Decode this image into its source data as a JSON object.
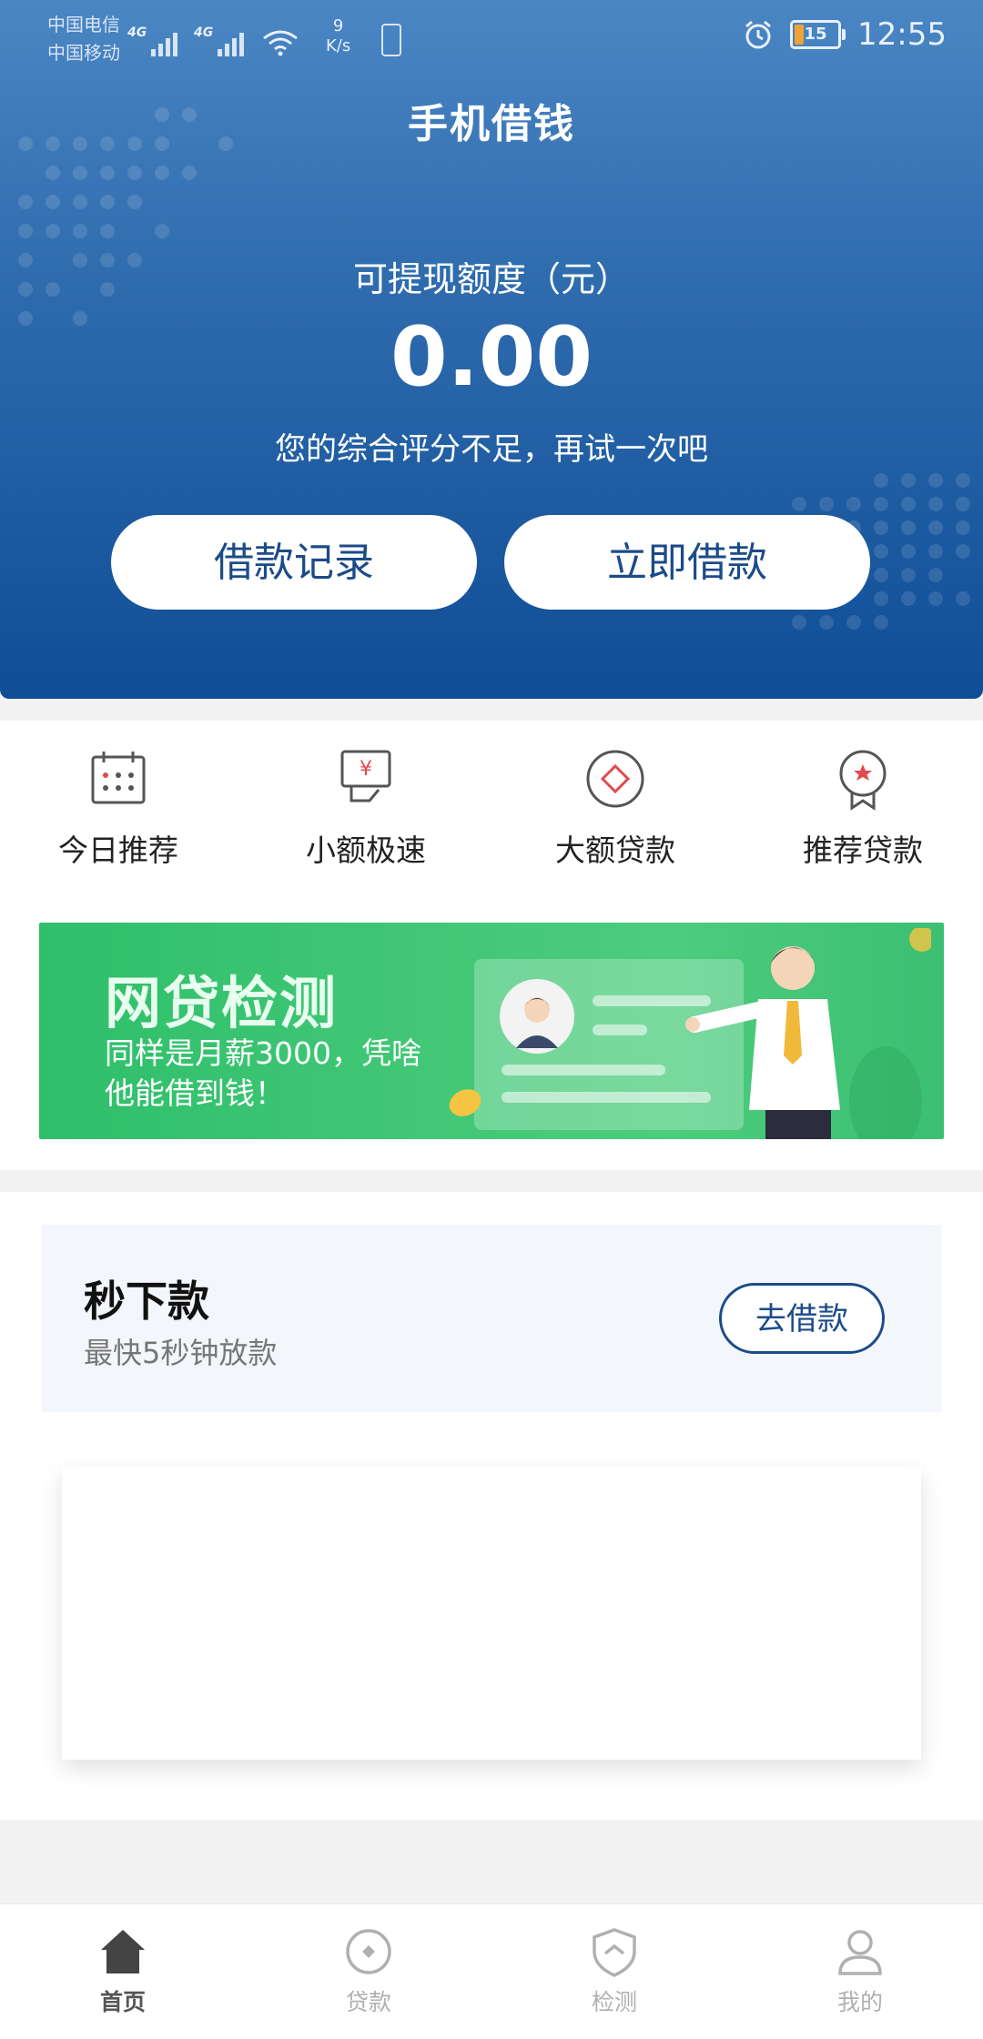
{
  "status_bar": {
    "carrier_1": "中国电信",
    "carrier_2": "中国移动",
    "net_1": "4G",
    "net_2": "4G",
    "speed_value": "9",
    "speed_unit": "K/s",
    "battery_level": "15",
    "time": "12:55"
  },
  "header": {
    "title": "手机借钱",
    "quota_label": "可提现额度（元）",
    "quota_amount": "0.00",
    "hint": "您的综合评分不足，再试一次吧",
    "btn_records": "借款记录",
    "btn_borrow": "立即借款"
  },
  "categories": [
    {
      "label": "今日推荐",
      "icon": "calendar-icon"
    },
    {
      "label": "小额极速",
      "icon": "money-hand-icon"
    },
    {
      "label": "大额贷款",
      "icon": "diamond-icon"
    },
    {
      "label": "推荐贷款",
      "icon": "award-icon"
    }
  ],
  "banner": {
    "title": "网贷检测",
    "subtitle": "同样是月薪3000，凭啥他能借到钱！"
  },
  "quick_loan": {
    "title": "秒下款",
    "subtitle": "最快5秒钟放款",
    "button": "去借款"
  },
  "bottom_nav": [
    {
      "label": "首页",
      "icon": "home-icon",
      "active": true
    },
    {
      "label": "贷款",
      "icon": "loan-icon",
      "active": false
    },
    {
      "label": "检测",
      "icon": "shield-icon",
      "active": false
    },
    {
      "label": "我的",
      "icon": "user-icon",
      "active": false
    }
  ],
  "colors": {
    "brand_blue": "#1b4b89",
    "header_top": "#4b86c4",
    "header_bottom": "#0f4d96",
    "banner_green": "#3cbf72",
    "accent_red": "#e04b4b"
  }
}
